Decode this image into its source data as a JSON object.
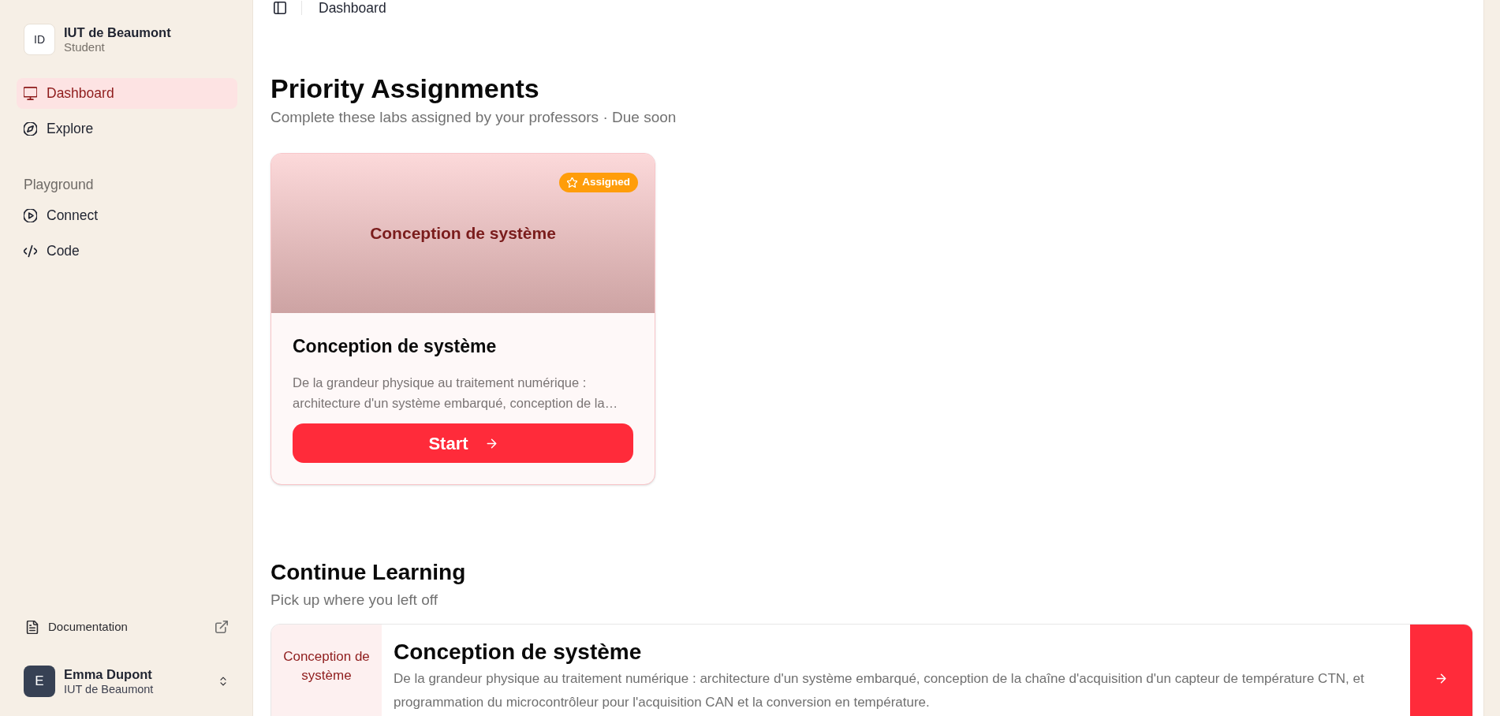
{
  "sidebar": {
    "org": {
      "initials": "ID",
      "name": "IUT de Beaumont",
      "role": "Student"
    },
    "nav": [
      {
        "label": "Dashboard",
        "selected": true
      },
      {
        "label": "Explore",
        "selected": false
      }
    ],
    "playground": {
      "title": "Playground",
      "items": [
        {
          "label": "Connect",
          "selected": false
        },
        {
          "label": "Code",
          "selected": false
        }
      ]
    },
    "documentation_link": "Documentation",
    "user": {
      "initial": "E",
      "name": "Emma Dupont",
      "org": "IUT de Beaumont"
    }
  },
  "top_bar": {
    "breadcrumb": "Dashboard"
  },
  "priority": {
    "title": "Priority Assignments",
    "subtitle": "Complete these labs assigned by your professors · Due soon",
    "cards": [
      {
        "cover_title": "Conception de système",
        "badge": "Assigned",
        "title": "Conception de système",
        "description": "De la grandeur physique au traitement numérique : architecture d'un système embarqué, conception de la…",
        "button": "Start"
      }
    ]
  },
  "continue_learning": {
    "title": "Continue Learning",
    "subtitle": "Pick up where you left off",
    "items": [
      {
        "thumbnail_label": "Conception de système",
        "title": "Conception de système",
        "description": "De la grandeur physique au traitement numérique : architecture d'un système embarqué, conception de la chaîne d'acquisition d'un capteur de température CTN, et programmation du microcontrôleur pour l'acquisition CAN et la conversion en température."
      }
    ]
  }
}
